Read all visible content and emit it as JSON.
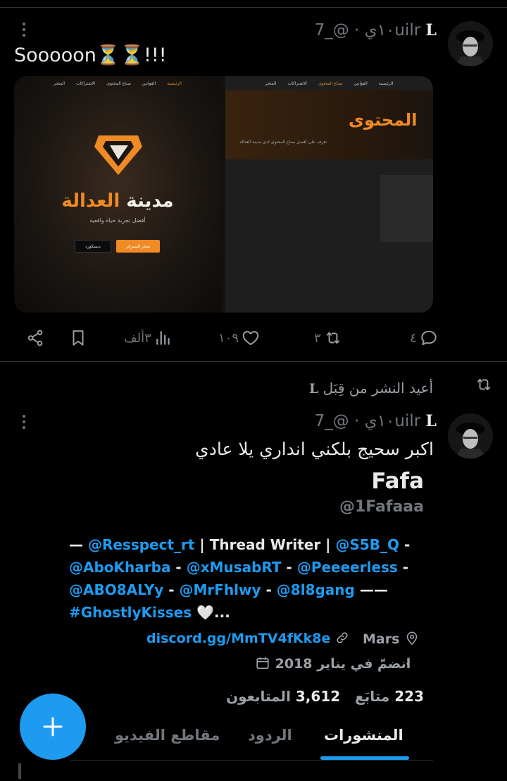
{
  "tweet1": {
    "author_initial": "L",
    "handle": "@_7uilr",
    "time": "١٠ي",
    "text": "Sooooon⏳⏳!!!",
    "media": {
      "left_nav": [
        "الرئيسية",
        "القوانين",
        "صناع المحتوى",
        "الاشتراكات",
        "المتجر"
      ],
      "left_title_accent": "العدالة",
      "left_title_rest": "مدينة",
      "left_subtitle": "أفضل تجربة حياة واقعية",
      "left_btn_primary": "متجر السيرفر",
      "left_btn_secondary": "ديسكورد",
      "right_nav": [
        "الرئيسية",
        "القوانين",
        "صناع المحتوى",
        "الاشتراكات",
        "المتجر"
      ],
      "right_title": "المحتوى",
      "right_subtitle": "تعرف على أفضل صناع المحتوى لدى مدينة العدالة"
    },
    "actions": {
      "replies": "٤",
      "reposts": "٣",
      "likes": "١٠٩",
      "views": "٣ألف"
    }
  },
  "tweet2": {
    "reposted_label": "أعيد النشر من قِبَل",
    "reposted_by_initial": "L",
    "author_initial": "L",
    "handle": "@_7uilr",
    "time": "١٠ي",
    "text": "اكبر سحيج بلكني انداري يلا عادي"
  },
  "profile_card": {
    "name": "Fafa",
    "handle": "@1Fafaaa",
    "bio_lines": [
      [
        {
          "t": "— ",
          "link": false
        },
        {
          "t": "@Resspect_rt",
          "link": true
        },
        {
          "t": " | Thread Writer | ",
          "link": false
        },
        {
          "t": "@S5B_Q",
          "link": true
        },
        {
          "t": " -",
          "link": false
        }
      ],
      [
        {
          "t": "@AboKharba",
          "link": true
        },
        {
          "t": " - ",
          "link": false
        },
        {
          "t": "@xMusabRT",
          "link": true
        },
        {
          "t": " - ",
          "link": false
        },
        {
          "t": "@Peeeerless",
          "link": true
        },
        {
          "t": " -",
          "link": false
        }
      ],
      [
        {
          "t": "@ABO8ALYy",
          "link": true
        },
        {
          "t": " - ",
          "link": false
        },
        {
          "t": "@MrFhlwy",
          "link": true
        },
        {
          "t": " - ",
          "link": false
        },
        {
          "t": "@8l8gang",
          "link": true
        },
        {
          "t": " ——",
          "link": false
        }
      ],
      [
        {
          "t": "#GhostlyKisses",
          "link": true
        },
        {
          "t": " 🤍...",
          "link": false
        }
      ]
    ],
    "location": "Mars",
    "website": "discord.gg/MmTV4fKk8e",
    "joined": "انضمّ في يناير 2018",
    "following_count": "223",
    "following_label": "متابَع",
    "followers_count": "3,612",
    "followers_label": "المتابعون"
  },
  "tabs": [
    "المنشورات",
    "الردود",
    "مقاطع الفيديو"
  ],
  "active_tab": "المنشورات",
  "colors": {
    "accent": "#1d9bf0",
    "background": "#000000",
    "text": "#e7e9ea",
    "muted": "#71767b",
    "brand_orange": "#f08a24"
  }
}
